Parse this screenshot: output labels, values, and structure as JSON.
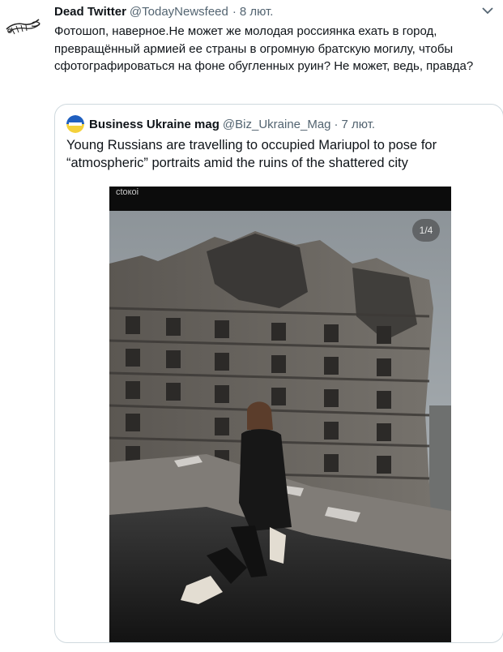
{
  "tweet": {
    "display_name": "Dead Twitter",
    "handle": "@TodayNewsfeed",
    "separator": "·",
    "date": "8 лют.",
    "text": "Фотошоп, наверное.Не может же молодая россиянка ехать в город, превращённый армией ее страны в огромную братскую могилу, чтобы сфотографироваться на фоне обугленных руин? Не может, ведь, правда?"
  },
  "quote": {
    "display_name": "Business Ukraine mag",
    "handle": "@Biz_Ukraine_Mag",
    "separator": "·",
    "date": "7 лют.",
    "text": "Young Russians are travelling to occupied Mariupol to pose for “atmospheric” portraits amid the ruins of the shattered city",
    "photo": {
      "counter": "1/4",
      "overlay_text": "ctoкoi"
    }
  },
  "icons": {
    "avatar": "quill-sketch-icon",
    "caret": "chevron-down-icon",
    "quote_avatar": "business-ukraine-logo"
  },
  "colors": {
    "text_primary": "#0f1419",
    "text_secondary": "#536471",
    "border": "#cfd9de",
    "flag_blue": "#1f5fbf",
    "flag_yellow": "#f4d13a"
  }
}
